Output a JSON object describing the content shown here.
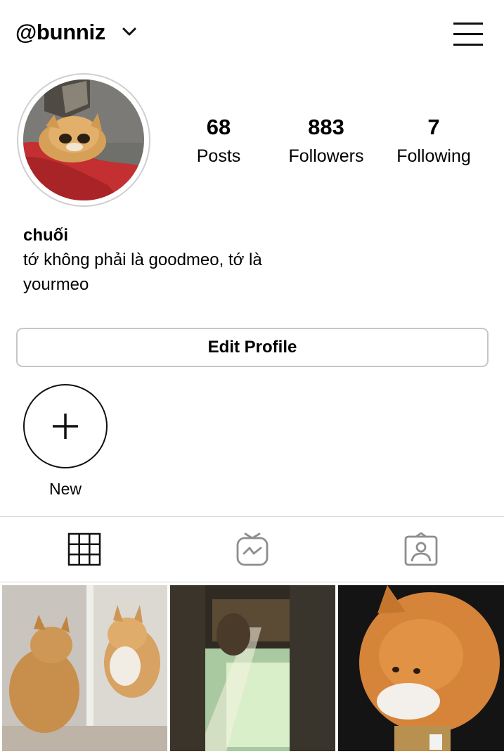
{
  "header": {
    "username": "@bunniz",
    "dropdown_icon": "chevron-down-icon",
    "menu_icon": "hamburger-menu-icon"
  },
  "profile": {
    "avatar_alt": "cat photo",
    "stats": [
      {
        "value": "68",
        "label": "Posts"
      },
      {
        "value": "883",
        "label": "Followers"
      },
      {
        "value": "7",
        "label": "Following"
      }
    ],
    "name": "chuối",
    "bio": "tớ không phải là goodmeo, tớ là yourmeo"
  },
  "actions": {
    "edit_profile_label": "Edit Profile"
  },
  "highlights": {
    "new_label": "New",
    "new_icon": "plus-icon"
  },
  "tabs": [
    {
      "icon": "grid-icon",
      "active": true
    },
    {
      "icon": "igtv-icon",
      "active": false
    },
    {
      "icon": "tagged-icon",
      "active": false
    }
  ],
  "colors": {
    "text": "#000000",
    "border": "#c7c7c7",
    "inactive_icon": "#8e8e8e"
  }
}
